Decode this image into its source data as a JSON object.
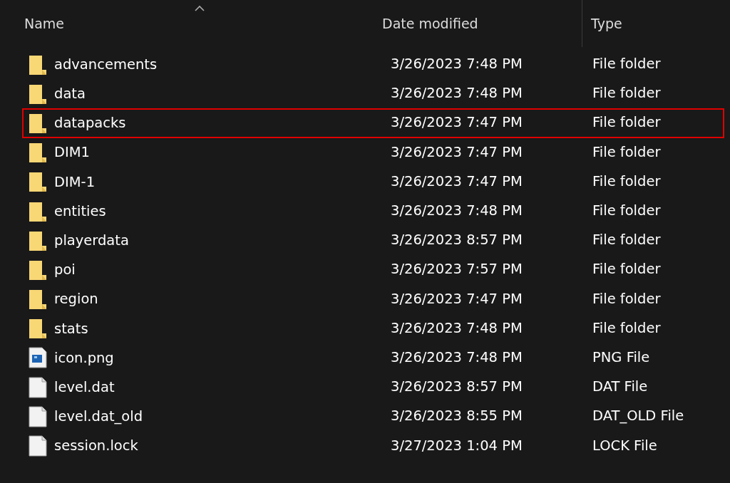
{
  "columns": [
    {
      "label": "Name",
      "sorted": true
    },
    {
      "label": "Date modified",
      "sorted": false
    },
    {
      "label": "Type",
      "sorted": false
    }
  ],
  "rows": [
    {
      "name": "advancements",
      "date": "3/26/2023 7:48 PM",
      "type": "File folder",
      "kind": "folder",
      "highlighted": false
    },
    {
      "name": "data",
      "date": "3/26/2023 7:48 PM",
      "type": "File folder",
      "kind": "folder",
      "highlighted": false
    },
    {
      "name": "datapacks",
      "date": "3/26/2023 7:47 PM",
      "type": "File folder",
      "kind": "folder",
      "highlighted": true
    },
    {
      "name": "DIM1",
      "date": "3/26/2023 7:47 PM",
      "type": "File folder",
      "kind": "folder",
      "highlighted": false
    },
    {
      "name": "DIM-1",
      "date": "3/26/2023 7:47 PM",
      "type": "File folder",
      "kind": "folder",
      "highlighted": false
    },
    {
      "name": "entities",
      "date": "3/26/2023 7:48 PM",
      "type": "File folder",
      "kind": "folder",
      "highlighted": false
    },
    {
      "name": "playerdata",
      "date": "3/26/2023 8:57 PM",
      "type": "File folder",
      "kind": "folder",
      "highlighted": false
    },
    {
      "name": "poi",
      "date": "3/26/2023 7:57 PM",
      "type": "File folder",
      "kind": "folder",
      "highlighted": false
    },
    {
      "name": "region",
      "date": "3/26/2023 7:47 PM",
      "type": "File folder",
      "kind": "folder",
      "highlighted": false
    },
    {
      "name": "stats",
      "date": "3/26/2023 7:48 PM",
      "type": "File folder",
      "kind": "folder",
      "highlighted": false
    },
    {
      "name": "icon.png",
      "date": "3/26/2023 7:48 PM",
      "type": "PNG File",
      "kind": "image",
      "highlighted": false
    },
    {
      "name": "level.dat",
      "date": "3/26/2023 8:57 PM",
      "type": "DAT File",
      "kind": "file",
      "highlighted": false
    },
    {
      "name": "level.dat_old",
      "date": "3/26/2023 8:55 PM",
      "type": "DAT_OLD File",
      "kind": "file",
      "highlighted": false
    },
    {
      "name": "session.lock",
      "date": "3/27/2023 1:04 PM",
      "type": "LOCK File",
      "kind": "file",
      "highlighted": false
    }
  ]
}
